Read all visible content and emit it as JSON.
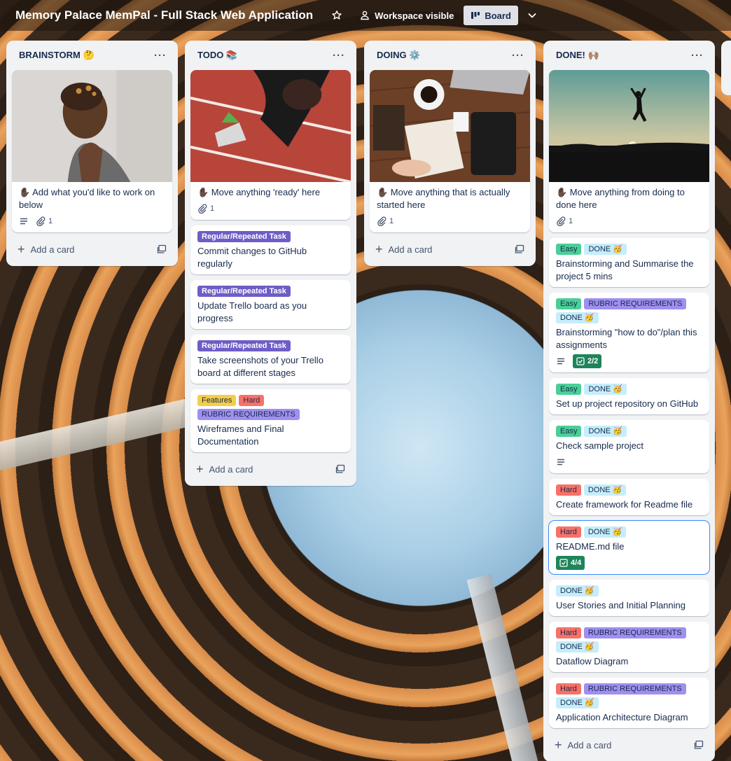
{
  "board": {
    "title": "Memory Palace MemPal - Full Stack Web Application",
    "visibility": "Workspace visible",
    "view": "Board"
  },
  "colors": {
    "regular": "#6e5dc6",
    "easy": "#4bce97",
    "done": "#c6edfb",
    "rubric": "#9f8fef",
    "hard": "#f87168",
    "features": "#f5cd47",
    "checklist_complete": "#1f845a"
  },
  "lists": {
    "brainstorm": {
      "title": "BRAINSTORM 🤔",
      "card1": {
        "title": "✋🏿 Add what you'd like to work on below",
        "attachments": "1"
      },
      "add": "Add a card"
    },
    "todo": {
      "title": "TODO 📚",
      "card1": {
        "title": "✋🏿 Move anything 'ready' here",
        "attachments": "1"
      },
      "card2": {
        "label1": "Regular/Repeated Task",
        "title": "Commit changes to GitHub regularly"
      },
      "card3": {
        "label1": "Regular/Repeated Task",
        "title": "Update Trello board as you progress"
      },
      "card4": {
        "label1": "Regular/Repeated Task",
        "title": "Take screenshots of your Trello board at different stages"
      },
      "card5": {
        "label1": "Features",
        "label2": "Hard",
        "label3": "RUBRIC REQUIREMENTS",
        "title": "Wireframes and Final Documentation"
      },
      "add": "Add a card"
    },
    "doing": {
      "title": "DOING ⚙️",
      "card1": {
        "title": "✋🏿 Move anything that is actually started here",
        "attachments": "1"
      },
      "add": "Add a card"
    },
    "done": {
      "title": "DONE! 🙌🏽",
      "card1": {
        "title": "✋🏿 Move anything from doing to done here",
        "attachments": "1"
      },
      "card2": {
        "label1": "Easy",
        "label2": "DONE 🥳",
        "title": "Brainstorming and Summarise the project 5 mins"
      },
      "card3": {
        "label1": "Easy",
        "label2": "RUBRIC REQUIREMENTS",
        "label3": "DONE 🥳",
        "title": "Brainstorming \"how to do\"/plan this assignments",
        "checklist": "2/2"
      },
      "card4": {
        "label1": "Easy",
        "label2": "DONE 🥳",
        "title": "Set up project repository on GitHub"
      },
      "card5": {
        "label1": "Easy",
        "label2": "DONE 🥳",
        "title": "Check sample project"
      },
      "card6": {
        "label1": "Hard",
        "label2": "DONE 🥳",
        "title": "Create framework for Readme file"
      },
      "card7": {
        "label1": "Hard",
        "label2": "DONE 🥳",
        "title": "README.md file",
        "checklist": "4/4"
      },
      "card8": {
        "label1": "DONE 🥳",
        "title": "User Stories and Initial Planning"
      },
      "card9": {
        "label1": "Hard",
        "label2": "RUBRIC REQUIREMENTS",
        "label3": "DONE 🥳",
        "title": "Dataflow Diagram"
      },
      "card10": {
        "label1": "Hard",
        "label2": "RUBRIC REQUIREMENTS",
        "label3": "DONE 🥳",
        "title": "Application Architecture Diagram"
      },
      "add": "Add a card"
    }
  }
}
